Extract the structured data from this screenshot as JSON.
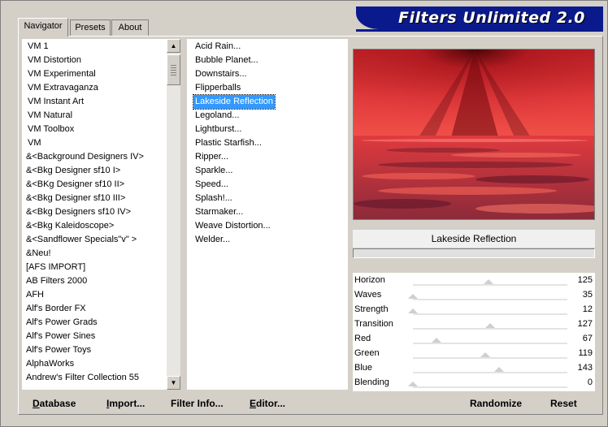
{
  "banner": {
    "title": "Filters Unlimited 2.0"
  },
  "tabs": [
    {
      "label": "Navigator",
      "active": true
    },
    {
      "label": "Presets",
      "active": false
    },
    {
      "label": "About",
      "active": false
    }
  ],
  "categories": [
    "VM 1",
    "VM Distortion",
    "VM Experimental",
    "VM Extravaganza",
    "VM Instant Art",
    "VM Natural",
    "VM Toolbox",
    "VM",
    "&<Background Designers IV>",
    "&<Bkg Designer sf10 I>",
    "&<BKg Designer sf10 II>",
    "&<Bkg Designer sf10 III>",
    "&<Bkg Designers sf10 IV>",
    "&<Bkg Kaleidoscope>",
    "&<Sandflower Specials\"v\" >",
    "&Neu!",
    "[AFS IMPORT]",
    "AB Filters 2000",
    "AFH",
    "Alf's Border FX",
    "Alf's Power Grads",
    "Alf's Power Sines",
    "Alf's Power Toys",
    "AlphaWorks",
    "Andrew's Filter Collection 55"
  ],
  "filters": [
    "Acid Rain...",
    "Bubble Planet...",
    "Downstairs...",
    "Flipperballs",
    "Lakeside Reflection",
    "Legoland...",
    "Lightburst...",
    "Plastic Starfish...",
    "Ripper...",
    "Sparkle...",
    "Speed...",
    "Splash!...",
    "Starmaker...",
    "Weave Distortion...",
    "Welder..."
  ],
  "selected_filter": "Lakeside Reflection",
  "preview": {
    "caption": "Lakeside Reflection",
    "progress": 0
  },
  "parameters": [
    {
      "name": "Horizon",
      "value": "125",
      "level": 0.49
    },
    {
      "name": "Waves",
      "value": "35",
      "level": 0.0
    },
    {
      "name": "Strength",
      "value": "12",
      "level": 0.0
    },
    {
      "name": "Transition",
      "value": "127",
      "level": 0.5
    },
    {
      "name": "Red",
      "value": "67",
      "level": 0.15
    },
    {
      "name": "Green",
      "value": "119",
      "level": 0.47
    },
    {
      "name": "Blue",
      "value": "143",
      "level": 0.56
    },
    {
      "name": "Blending",
      "value": "0",
      "level": 0.0
    }
  ],
  "buttons": {
    "database": "Database",
    "import": "Import...",
    "filter_info": "Filter Info...",
    "editor": "Editor...",
    "randomize": "Randomize",
    "reset": "Reset"
  },
  "colors": {
    "banner": "#0a1a8c",
    "selection": "#3399ff",
    "preview_red": "#e8343a"
  }
}
